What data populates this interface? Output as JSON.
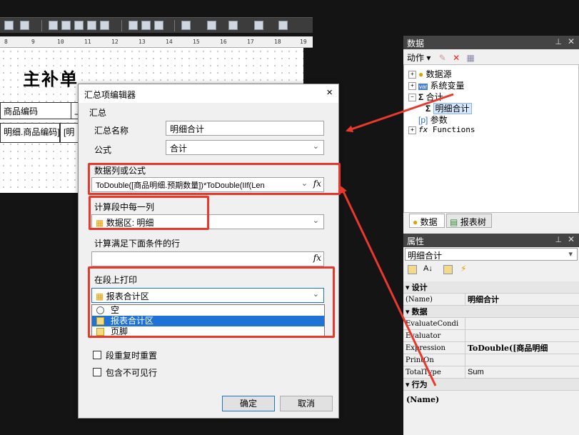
{
  "ruler": {
    "ticks": [
      "8",
      "9",
      "10",
      "11",
      "12",
      "13",
      "14",
      "15",
      "16",
      "17",
      "18",
      "19"
    ]
  },
  "report": {
    "title": "主补单",
    "header_cells": [
      "商品编码",
      "上"
    ],
    "data_cells": [
      "明细.商品编码]",
      "[明"
    ]
  },
  "dialog": {
    "title": "汇总项编辑器",
    "close": "×",
    "group_label": "汇总",
    "name_label": "汇总名称",
    "name_value": "明细合计",
    "formula_label": "公式",
    "formula_value": "合计",
    "expr_label": "数据列或公式",
    "expr_value": "ToDouble([商品明细.预期数量])*ToDouble(IIf(Len",
    "per_row_label": "计算段中每一列",
    "per_row_value": "数据区: 明细",
    "cond_label": "计算满足下面条件的行",
    "cond_value": "",
    "print_label": "在段上打印",
    "print_value": "报表合计区",
    "options": [
      {
        "label": "空",
        "icon": "no-entry-icon"
      },
      {
        "label": "报表合计区",
        "icon": "band-icon"
      },
      {
        "label": "页脚",
        "icon": "band-icon"
      }
    ],
    "checkbox_reset": "段重复时重置",
    "checkbox_invisible": "包含不可见行",
    "ok": "确定",
    "cancel": "取消",
    "fx": "fx"
  },
  "data_panel": {
    "title": "数据",
    "action_label": "动作",
    "tree": [
      {
        "label": "数据源",
        "expander": "+"
      },
      {
        "label": "系统变量",
        "expander": "+"
      },
      {
        "label": "合计",
        "expander": "−"
      },
      {
        "label": "明细合计",
        "expander": ""
      },
      {
        "label": "参数",
        "expander": ""
      },
      {
        "label": "Functions",
        "expander": "+"
      }
    ],
    "tabs": [
      "数据",
      "报表树"
    ]
  },
  "properties_panel": {
    "title": "属性",
    "object": "明细合计",
    "rows": [
      {
        "key": "设计",
        "value": "",
        "category": true
      },
      {
        "key": "(Name)",
        "value": "明细合计"
      },
      {
        "key": "数据",
        "value": "",
        "category": true
      },
      {
        "key": "EvaluateCondi",
        "value": ""
      },
      {
        "key": "Evaluator",
        "value": ""
      },
      {
        "key": "Expression",
        "value": "ToDouble([商品明细"
      },
      {
        "key": "PrintOn",
        "value": ""
      },
      {
        "key": "TotalType",
        "value": "Sum"
      },
      {
        "key": "行为",
        "value": "",
        "category": true
      }
    ],
    "description": "(Name)"
  },
  "colors": {
    "highlight_red": "#e8392c",
    "selection_blue": "#1f72d6"
  }
}
